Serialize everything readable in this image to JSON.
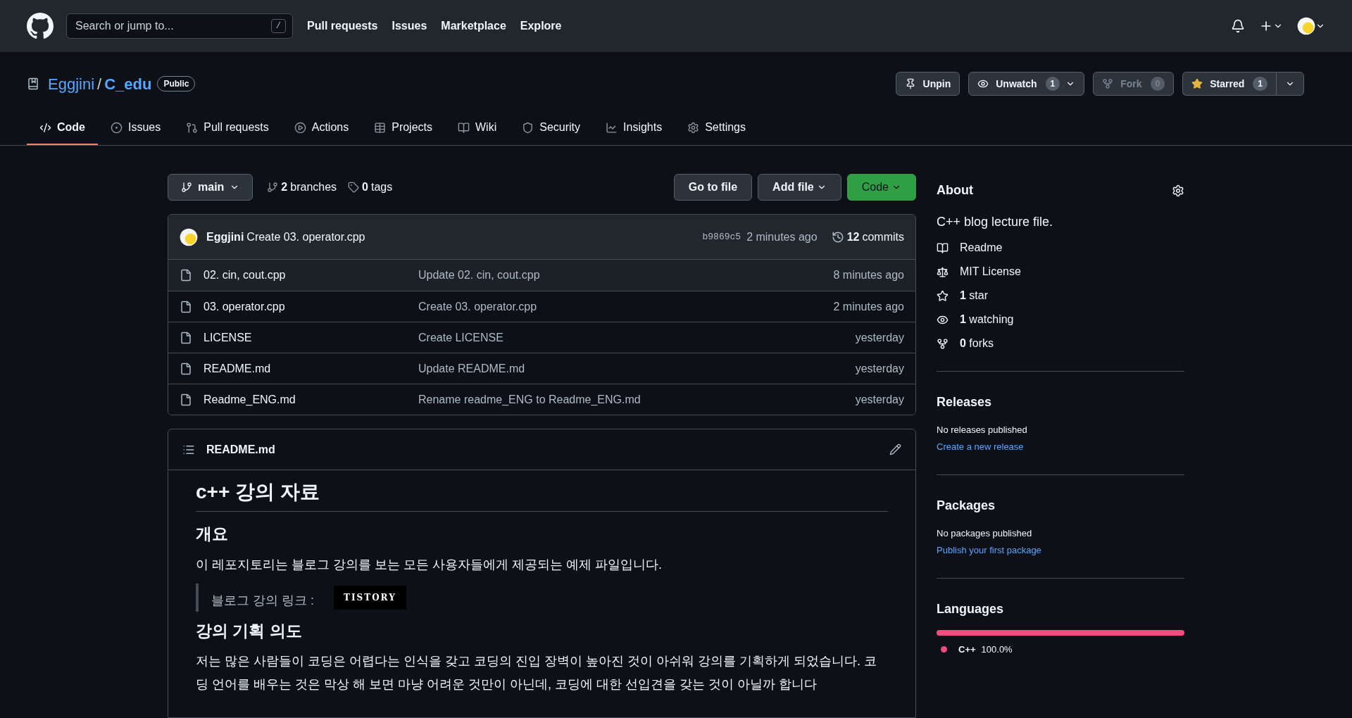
{
  "header": {
    "search": {
      "placeholder": "Search or jump to...",
      "key": "/"
    },
    "nav": [
      "Pull requests",
      "Issues",
      "Marketplace",
      "Explore"
    ]
  },
  "repo": {
    "owner": "Eggjini",
    "separator": "/",
    "name": "C_edu",
    "visibility": "Public",
    "actions": [
      {
        "kind": "pin",
        "label": "Unpin",
        "disabled": false
      },
      {
        "kind": "watch",
        "label": "Unwatch",
        "count": "1",
        "disabled": false
      },
      {
        "kind": "fork",
        "label": "Fork",
        "count": "0",
        "disabled": true
      },
      {
        "kind": "star",
        "label": "Starred",
        "count": "1",
        "disabled": false
      }
    ]
  },
  "tabs": [
    {
      "kind": "code",
      "label": "Code",
      "selected": true
    },
    {
      "kind": "issues",
      "label": "Issues",
      "selected": false
    },
    {
      "kind": "pulls",
      "label": "Pull requests",
      "selected": false
    },
    {
      "kind": "actions",
      "label": "Actions",
      "selected": false
    },
    {
      "kind": "projects",
      "label": "Projects",
      "selected": false
    },
    {
      "kind": "wiki",
      "label": "Wiki",
      "selected": false
    },
    {
      "kind": "security",
      "label": "Security",
      "selected": false
    },
    {
      "kind": "insights",
      "label": "Insights",
      "selected": false
    },
    {
      "kind": "settings",
      "label": "Settings",
      "selected": false
    }
  ],
  "toolbar": {
    "branch": "main",
    "branches_count": "2",
    "branches_label": "branches",
    "tags_count": "0",
    "tags_label": "tags",
    "go_to_file": "Go to file",
    "add_file": "Add file",
    "code": "Code"
  },
  "commit": {
    "author": "Eggjini",
    "message": "Create 03. operator.cpp",
    "hash": "b9869c5",
    "time": "2 minutes ago",
    "count": "12",
    "count_label": "commits"
  },
  "files": [
    {
      "name": "02. cin, cout.cpp",
      "message": "Update 02. cin, cout.cpp",
      "time": "8 minutes ago",
      "hovered": true
    },
    {
      "name": "03. operator.cpp",
      "message": "Create 03. operator.cpp",
      "time": "2 minutes ago",
      "hovered": false
    },
    {
      "name": "LICENSE",
      "message": "Create LICENSE",
      "time": "yesterday",
      "hovered": false
    },
    {
      "name": "README.md",
      "message": "Update README.md",
      "time": "yesterday",
      "hovered": false
    },
    {
      "name": "Readme_ENG.md",
      "message": "Rename readme_ENG to Readme_ENG.md",
      "time": "yesterday",
      "hovered": false
    }
  ],
  "readme": {
    "title": "README.md",
    "content": [
      {
        "kind": "h1",
        "text": "c++ 강의 자료"
      },
      {
        "kind": "h2",
        "text": "개요"
      },
      {
        "kind": "p",
        "text": "이 레포지토리는 블로그 강의를 보는 모든 사용자들에게 제공되는 예제 파일입니다."
      },
      {
        "kind": "quote",
        "text": "블로그 강의 링크 :",
        "badge": "TISTORY"
      },
      {
        "kind": "h2",
        "text": "강의 기획 의도"
      },
      {
        "kind": "p",
        "text": "저는 많은 사람들이 코딩은 어렵다는 인식을 갖고 코딩의 진입 장벽이 높아진 것이 아쉬워 강의를 기획하게 되었습니다. 코딩 언어를 배우는 것은 막상 해 보면 마냥 어려운 것만이 아닌데, 코딩에 대한 선입견을 갖는 것이 아닐까 합니다"
      }
    ]
  },
  "about": {
    "title": "About",
    "description": "C++ blog lecture file.",
    "items": [
      {
        "kind": "readme",
        "text": "Readme"
      },
      {
        "kind": "license",
        "text": "MIT License"
      },
      {
        "kind": "star",
        "count": "1",
        "text": "star"
      },
      {
        "kind": "watch",
        "count": "1",
        "text": "watching"
      },
      {
        "kind": "fork",
        "count": "0",
        "text": "forks"
      }
    ]
  },
  "releases": {
    "title": "Releases",
    "note": "No releases published",
    "link": "Create a new release"
  },
  "packages": {
    "title": "Packages",
    "note": "No packages published",
    "link": "Publish your first package"
  },
  "languages": {
    "title": "Languages",
    "items": [
      {
        "name": "C++",
        "percent": "100.0%",
        "level": 1,
        "color": "#f34b7d"
      }
    ]
  }
}
